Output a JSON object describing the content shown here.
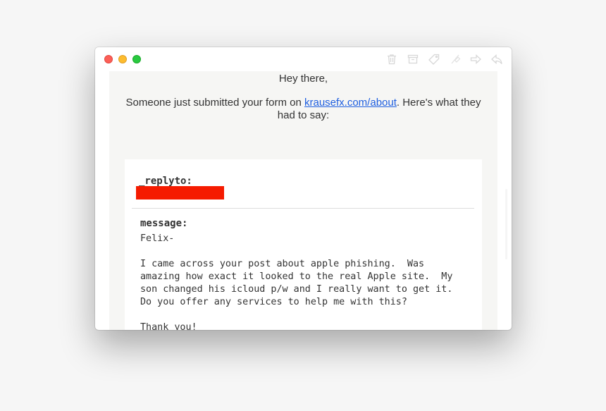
{
  "window": {
    "traffic_lights": [
      "close",
      "minimize",
      "zoom"
    ],
    "toolbar_icons": [
      "trash-icon",
      "archive-icon",
      "tag-icon",
      "flag-icon",
      "forward-icon",
      "reply-icon"
    ]
  },
  "email": {
    "greeting": "Hey there,",
    "intro_before": "Someone just submitted your form on ",
    "intro_link": "krausefx.com/about",
    "intro_after": ". Here's what they had to say:",
    "fields": {
      "replyto_label": "_replyto:",
      "message_label": "message:",
      "message_body": "Felix-\n\nI came across your post about apple phishing.  Was\namazing how exact it looked to the real Apple site.  My\nson changed his icloud p/w and I really want to get it.\nDo you offer any services to help me with this?\n\nThank you!"
    }
  },
  "colors": {
    "redaction": "#f51b00",
    "link": "#1f5fe0",
    "email_background": "#f6f6f4"
  }
}
